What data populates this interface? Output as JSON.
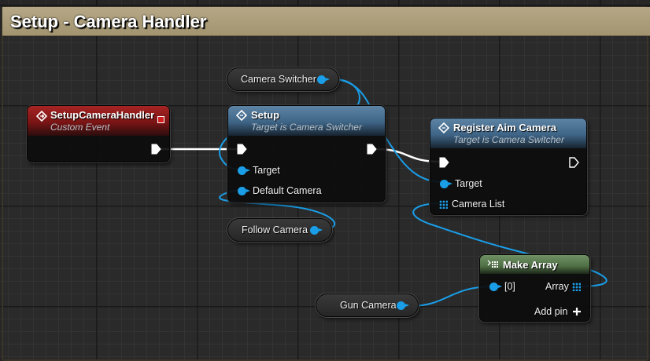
{
  "comment": {
    "title": "Setup - Camera Handler"
  },
  "nodes": {
    "event": {
      "title": "SetupCameraHandler",
      "subtitle": "Custom Event"
    },
    "setup": {
      "title": "Setup",
      "subtitle": "Target is Camera Switcher",
      "pins": {
        "target": "Target",
        "default_camera": "Default Camera"
      }
    },
    "register": {
      "title": "Register Aim Camera",
      "subtitle": "Target is Camera Switcher",
      "pins": {
        "target": "Target",
        "camera_list": "Camera List"
      }
    },
    "make_array": {
      "title": "Make Array",
      "pins": {
        "in0": "[0]",
        "array": "Array",
        "add_pin": "Add pin"
      }
    }
  },
  "variables": {
    "camera_switcher": "Camera Switcher",
    "follow_camera": "Follow Camera",
    "gun_camera": "Gun Camera"
  },
  "colors": {
    "comment_header": "#b6a887",
    "event_header": "#8b1c1c",
    "function_header": "#4b7196",
    "pure_header": "#5d7c52",
    "object_wire": "#1a9ee8",
    "exec_wire": "#ffffff"
  },
  "icons": {
    "function": "function-diamond-icon",
    "event": "event-diamond-icon",
    "make_array": "make-array-icon",
    "add_pin": "plus-icon"
  }
}
